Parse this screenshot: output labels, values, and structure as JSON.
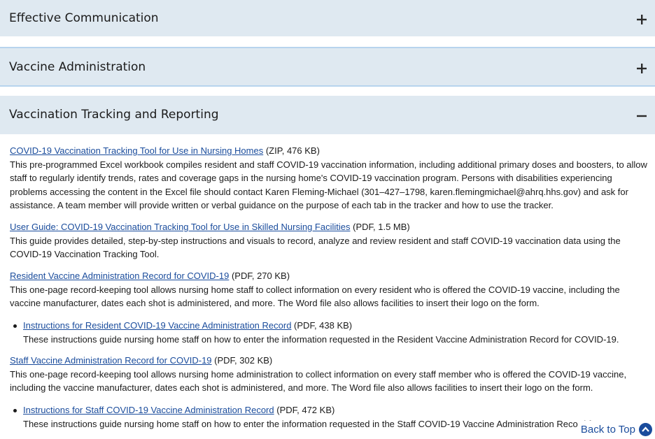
{
  "accordions": [
    {
      "title": "Effective Communication",
      "state_icon": "plus-icon"
    },
    {
      "title": "Vaccine Administration",
      "state_icon": "plus-icon"
    },
    {
      "title": "Vaccination Tracking and Reporting",
      "state_icon": "minus-icon"
    }
  ],
  "resources": [
    {
      "link": "COVID-19 Vaccination Tracking Tool for Use in Nursing Homes",
      "meta": " (ZIP, 476 KB)",
      "desc": "This pre-programmed Excel workbook compiles resident and staff COVID-19 vaccination information, including additional primary doses and boosters, to allow staff to regularly identify trends, rates and coverage gaps in the nursing home's COVID-19 vaccination program. Persons with disabilities experiencing problems accessing the content in the Excel file should contact Karen Fleming-Michael (301–427–1798, karen.flemingmichael@ahrq.hhs.gov) and ask for assistance. A team member will provide written or verbal guidance on the purpose of each tab in the tracker and how to use the tracker."
    },
    {
      "link": "User Guide: COVID-19 Vaccination Tracking Tool for Use in Skilled Nursing Facilities",
      "meta": " (PDF, 1.5 MB)",
      "desc": "This guide provides detailed, step-by-step instructions and visuals to record, analyze and review resident and staff COVID-19 vaccination data using the COVID-19 Vaccination Tracking Tool."
    },
    {
      "link": "Resident Vaccine Administration Record for COVID-19",
      "meta": " (PDF, 270 KB)",
      "desc": "This one-page record-keeping tool allows nursing home staff to collect information on every resident who is offered the COVID-19 vaccine, including the vaccine manufacturer, dates each shot is administered, and more. The Word file also allows facilities to insert their logo on the form."
    },
    {
      "link": "Instructions for Resident COVID-19 Vaccine Administration Record",
      "meta": " (PDF, 438 KB)",
      "desc": "These instructions guide nursing home staff on how to enter the information requested in the Resident Vaccine Administration Record for COVID-19."
    },
    {
      "link": "Staff Vaccine Administration Record for COVID-19",
      "meta": " (PDF, 302 KB)",
      "desc": "This one-page record-keeping tool allows nursing home administration to collect information on every staff member who is offered the COVID-19 vaccine, including the vaccine manufacturer, dates each shot is administered, and more. The Word file also allows facilities to insert their logo on the form."
    },
    {
      "link": "Instructions for Staff COVID-19 Vaccine Administration Record",
      "meta": " (PDF, 472 KB)",
      "desc": "These instructions guide nursing home staff on how to enter the information requested in the Staff COVID-19 Vaccine Administration Record for COVID-19."
    }
  ],
  "back_to_top": "Back to Top",
  "colors": {
    "header_bg": "#dfe9f1",
    "link": "#1a4c9c",
    "header_border": "#b7d4ee"
  }
}
